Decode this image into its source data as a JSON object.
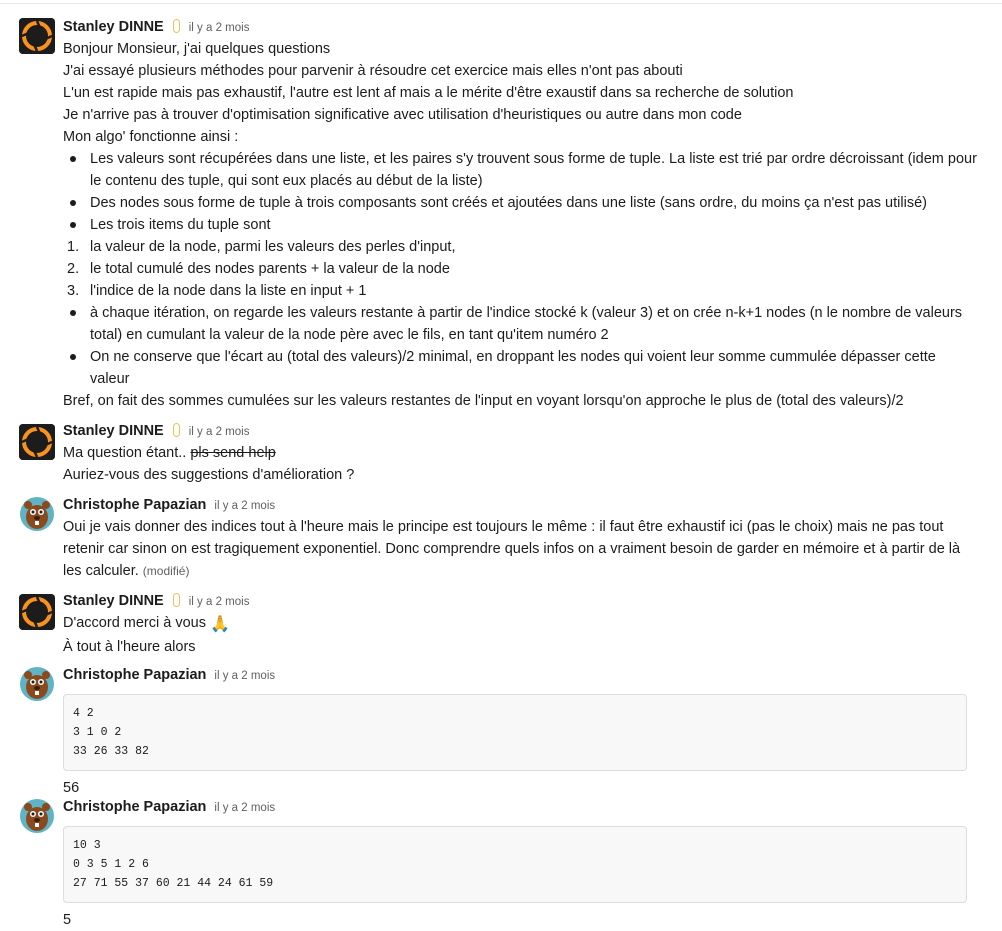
{
  "messages": [
    {
      "author": "Stanley DINNE",
      "time": "il y a 2 mois",
      "lines": [
        "Bonjour Monsieur, j'ai quelques questions",
        "J'ai essayé plusieurs méthodes pour parvenir à résoudre cet exercice mais elles n'ont pas abouti",
        "L'un est rapide mais pas exhaustif, l'autre est lent af mais a le mérite d'être exaustif dans sa recherche de solution",
        "Je n'arrive pas à trouver d'optimisation significative avec utilisation d'heuristiques ou autre dans mon code",
        "Mon algo' fonctionne ainsi :"
      ],
      "list": [
        {
          "marker": "bullet",
          "text1": "Les valeurs sont récupérées dans une liste, et les paires s'y trouvent sous forme de tuple. La liste est trié par ordre décroissant (idem pour",
          "text2": "le contenu des tuple, qui sont eux placés au début de la liste)"
        },
        {
          "marker": "bullet",
          "text1": "Des nodes sous forme de tuple à trois composants sont créés et ajoutées dans une liste (sans ordre, du moins ça n'est pas utilisé)"
        },
        {
          "marker": "bullet",
          "text1": "Les trois items du tuple sont"
        },
        {
          "marker": "1.",
          "text1": "la valeur de la node, parmi les valeurs des perles d'input,"
        },
        {
          "marker": "2.",
          "text1": "le total cumulé des nodes parents + la valeur de la node"
        },
        {
          "marker": "3.",
          "text1": "l'indice de la node dans la liste en input + 1"
        },
        {
          "marker": "bullet",
          "text1": "à chaque itération, on regarde les valeurs restante à partir de l'indice stocké k (valeur 3) et on crée n-k+1 nodes (n le nombre de valeurs",
          "text2": "total) en cumulant la valeur de la node père avec le fils, en tant qu'item numéro 2"
        },
        {
          "marker": "bullet",
          "text1": "On ne conserve que l'écart au (total des valeurs)/2 minimal, en droppant les nodes qui voient leur somme cummulée dépasser cette",
          "text2": "valeur"
        }
      ],
      "footer": "Bref, on fait des sommes cumulées sur les valeurs restantes de l'input en voyant lorsqu'on approche le plus de (total des valeurs)/2"
    },
    {
      "author": "Stanley DINNE",
      "time": "il y a 2 mois",
      "line1_prefix": "Ma question étant.. ",
      "line1_strike": "pls send help",
      "line2": "Auriez-vous des suggestions d'amélioration ?"
    },
    {
      "author": "Christophe Papazian",
      "time": "il y a 2 mois",
      "lines": [
        "Oui je vais donner des indices tout à l'heure mais le principe est toujours le même : il faut être exhaustif ici (pas le choix) mais ne pas tout",
        "retenir car sinon on est tragiquement exponentiel. Donc comprendre quels infos on a vraiment besoin de garder en mémoire et à partir de là",
        "les calculer."
      ],
      "edited": "(modifié)"
    },
    {
      "author": "Stanley DINNE",
      "time": "il y a 2 mois",
      "line1": "D'accord merci à vous",
      "emoji": "🙏",
      "line2": "À tout à l'heure alors"
    },
    {
      "author": "Christophe Papazian",
      "time": "il y a 2 mois",
      "code": [
        "4 2",
        "3 1 0 2",
        "33 26 33 82"
      ],
      "after": "56"
    },
    {
      "author": "Christophe Papazian",
      "time": "il y a 2 mois",
      "code": [
        "10 3",
        "0 3 5 1 2 6",
        "27 71 55 37 60 21 44 24 61 59"
      ],
      "after": "5"
    }
  ],
  "colors": {
    "status": "#e8c25a",
    "portal_orange": "#f7931e",
    "beaver_teal": "#5fb3c5"
  }
}
